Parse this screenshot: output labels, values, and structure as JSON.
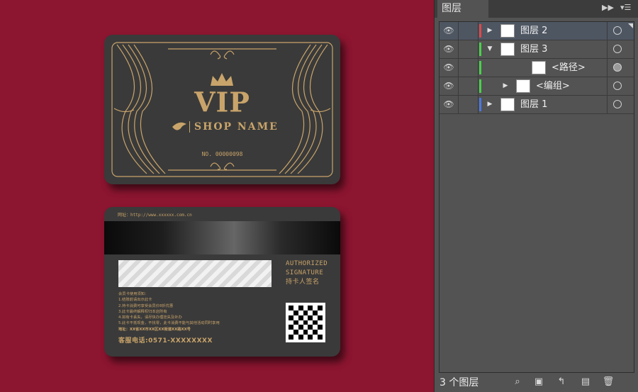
{
  "front_card": {
    "title": "VIP",
    "shop_name": "SHOP NAME",
    "card_no": "NO. 00000098"
  },
  "back_card": {
    "website": "网址：http://www.xxxxxx.com.cn",
    "signature_labels": [
      "AUTHORIZED",
      "SIGNATURE",
      "持卡人签名"
    ],
    "notice_lines": [
      "会员卡使用须知：",
      "1.结账前请出示此卡",
      "2.持卡消费可享受会员价8折优惠",
      "3.此卡最终解释权归本店所有",
      "4.如有卡丢失，请尽快办理挂失及补办",
      "5.此卡不抵现金，不找零，此卡消费不能与其他活动同时享用",
      "地址：XX省XX市XX区XX街道XX路XX号"
    ],
    "hotline": "客服电话:0571-XXXXXXXX"
  },
  "panel": {
    "tab_label": "图层",
    "layer_count": "3 个图层",
    "layers": [
      {
        "name": "图层 2",
        "color": "#e0474c",
        "expand": "▶",
        "indent": 0,
        "selected": true
      },
      {
        "name": "图层 3",
        "color": "#4ccf4c",
        "expand": "▼",
        "indent": 0,
        "selected": false
      },
      {
        "name": "<路径>",
        "color": "#4ccf4c",
        "expand": "",
        "indent": 2,
        "selected": false
      },
      {
        "name": "<编组>",
        "color": "#4ccf4c",
        "expand": "▶",
        "indent": 1,
        "selected": false
      },
      {
        "name": "图层 1",
        "color": "#4a78e0",
        "expand": "▶",
        "indent": 0,
        "selected": false
      }
    ]
  }
}
